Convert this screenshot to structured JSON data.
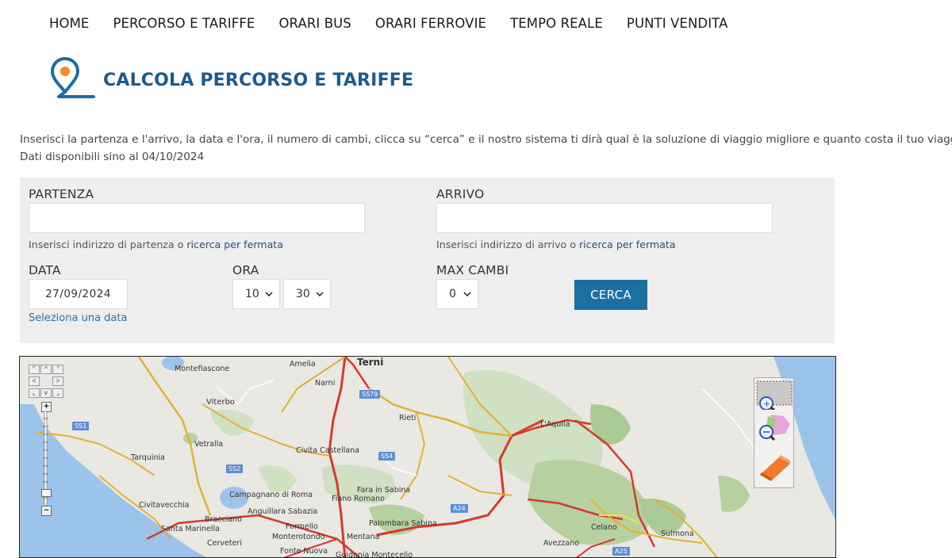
{
  "nav": {
    "items": [
      "HOME",
      "PERCORSO E TARIFFE",
      "ORARI BUS",
      "ORARI FERROVIE",
      "TEMPO REALE",
      "PUNTI VENDITA"
    ]
  },
  "header": {
    "title": "CALCOLA PERCORSO E TARIFFE",
    "logo_colors": {
      "pin": "#1a6fa2",
      "dot": "#f28c28"
    }
  },
  "intro": {
    "line1": "Inserisci la partenza e l'arrivo, la data e l'ora, il numero di cambi, clicca su “cerca” e il nostro sistema ti dirà qual è la soluzione di viaggio migliore e quanto costa il tuo viaggio.",
    "line2": "Dati disponibili sino al 04/10/2024"
  },
  "form": {
    "partenza": {
      "label": "PARTENZA",
      "value": "",
      "helper_prefix": "Inserisci indirizzo di partenza o ",
      "helper_link": "ricerca per fermata"
    },
    "arrivo": {
      "label": "ARRIVO",
      "value": "",
      "helper_prefix": "Inserisci indirizzo di arrivo o ",
      "helper_link": "ricerca per fermata"
    },
    "data": {
      "label": "DATA",
      "value": "27/09/2024",
      "link": "Seleziona una data"
    },
    "ora": {
      "label": "ORA",
      "hour": "10",
      "minute": "30"
    },
    "max_cambi": {
      "label": "MAX CAMBI",
      "value": "0"
    },
    "search_button": "CERCA",
    "accent_color": "#1b6fa2"
  },
  "map": {
    "cities": [
      "Terni",
      "Montefiascone",
      "Amelia",
      "Narni",
      "Viterbo",
      "Rieti",
      "L'Aquila",
      "Vetralla",
      "Civita Castellana",
      "Tarquinia",
      "Fara in Sabina",
      "Civitavecchia",
      "Campagnano di Roma",
      "Fiano Romano",
      "Anguillara Sabazia",
      "Bracciano",
      "Santa Marinella",
      "Formello",
      "Palombara Sabina",
      "Celano",
      "Sulmona",
      "Monterotondo",
      "Mentana",
      "Avezzano",
      "Cerveteri",
      "Fonte Nuova",
      "Guidonia Montecelio"
    ],
    "road_shields": [
      "SS79",
      "SS1",
      "SS4",
      "SS2",
      "A24",
      "A25"
    ],
    "zoom_buttons": [
      "+",
      "−"
    ],
    "tools": [
      "zoom-box-icon",
      "zoom-in-icon",
      "zoom-region-icon",
      "eraser-icon"
    ]
  }
}
